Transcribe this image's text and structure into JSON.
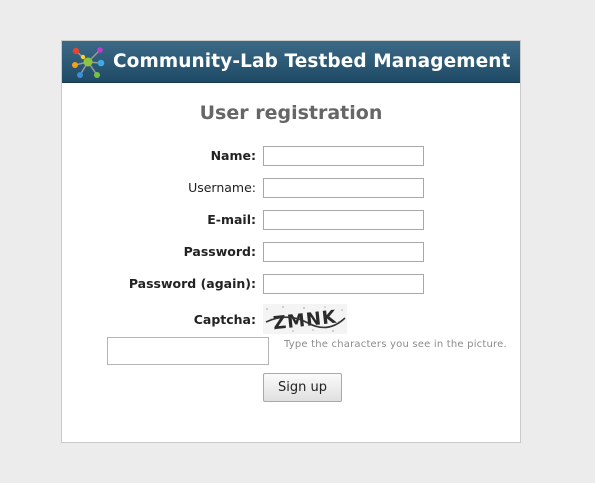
{
  "header": {
    "title": "Community-Lab Testbed Management",
    "logo_icon": "network-nodes-logo-icon"
  },
  "page": {
    "title": "User registration"
  },
  "form": {
    "name": {
      "label": "Name:",
      "value": ""
    },
    "username": {
      "label": "Username:",
      "value": ""
    },
    "email": {
      "label": "E-mail:",
      "value": ""
    },
    "password": {
      "label": "Password:",
      "value": ""
    },
    "password_again": {
      "label": "Password (again):",
      "value": ""
    },
    "captcha": {
      "label": "Captcha:",
      "image_text": "ZMNK",
      "value": "",
      "help_text": "Type the characters you see in the picture."
    },
    "submit_label": "Sign up"
  },
  "colors": {
    "background": "#ececec",
    "header_top": "#3c6a86",
    "header_bottom": "#1e4a66",
    "title_gray": "#666666"
  }
}
